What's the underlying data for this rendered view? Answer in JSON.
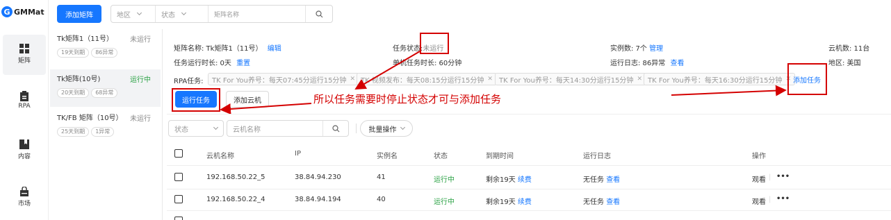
{
  "app": {
    "logo_letter": "G",
    "logo_text": "GMMat",
    "brand_color": "#1677ff"
  },
  "nav": [
    {
      "label": "矩阵",
      "icon": "grid-icon",
      "active": true
    },
    {
      "label": "RPA",
      "icon": "clipboard-icon"
    },
    {
      "label": "内容",
      "icon": "bookmark-icon"
    },
    {
      "label": "市场",
      "icon": "shopping-bag-icon"
    }
  ],
  "toolbar": {
    "add_matrix": "添加矩阵",
    "region_placeholder": "地区",
    "status_placeholder": "状态",
    "name_placeholder": "矩阵名称"
  },
  "matrices": [
    {
      "name": "Tk矩阵1（11号）",
      "status": "未运行",
      "tags": [
        "19天到期",
        "86异常"
      ]
    },
    {
      "name": "Tk矩阵(10号)",
      "status": "运行中",
      "tags": [
        "20天到期",
        "68异常"
      ]
    },
    {
      "name": "TK/FB 矩阵（10号）",
      "status": "未运行",
      "tags": [
        "25天到期",
        "1异常"
      ]
    }
  ],
  "detail": {
    "name_label": "矩阵名称: Tk矩阵1（11号）",
    "edit": "编辑",
    "task_status_label": "任务状态:",
    "task_status_value": "未运行",
    "instances_label": "实例数: 7个",
    "manage": "管理",
    "cloud_count": "云机数: 11台",
    "runtime_label": "任务运行时长: 0天",
    "reset": "重置",
    "single_runtime": "单机任务时长: 60分钟",
    "runlog_label": "运行日志: 86异常",
    "view": "查看",
    "region": "地区: 美国",
    "rpa_label": "RPA任务:",
    "rpa_tasks": [
      "TK For You养号：每天07:45分运行15分钟",
      "TK 视频发布：每天08:15分运行15分钟",
      "TK For You养号：每天14:30分运行15分钟",
      "TK For You养号：每天16:30分运行15分钟"
    ],
    "add_task": "添加任务",
    "run_task": "运行任务",
    "add_cloud": "添加云机"
  },
  "annotation": "所以任务需要时停止状态才可与添加任务",
  "filter": {
    "status_placeholder": "状态",
    "cloud_name_placeholder": "云机名称",
    "batch": "批量操作"
  },
  "table": {
    "headers": [
      "云机名称",
      "IP",
      "实例名",
      "状态",
      "到期时间",
      "运行日志",
      "操作"
    ],
    "rows": [
      {
        "name": "192.168.50.22_5",
        "ip": "38.84.94.230",
        "instance": "41",
        "status": "运行中",
        "expire": "剩余19天",
        "renew": "续费",
        "log": "无任务",
        "view": "查看",
        "watch": "观看",
        "more": "•••"
      },
      {
        "name": "192.168.50.22_4",
        "ip": "38.84.94.194",
        "instance": "40",
        "status": "运行中",
        "expire": "剩余19天",
        "renew": "续费",
        "log": "无任务",
        "view": "查看",
        "watch": "观看",
        "more": "•••"
      }
    ]
  },
  "colors": {
    "annotation_red": "#d40000",
    "running_green": "#2ba245",
    "link_blue": "#1677ff"
  }
}
